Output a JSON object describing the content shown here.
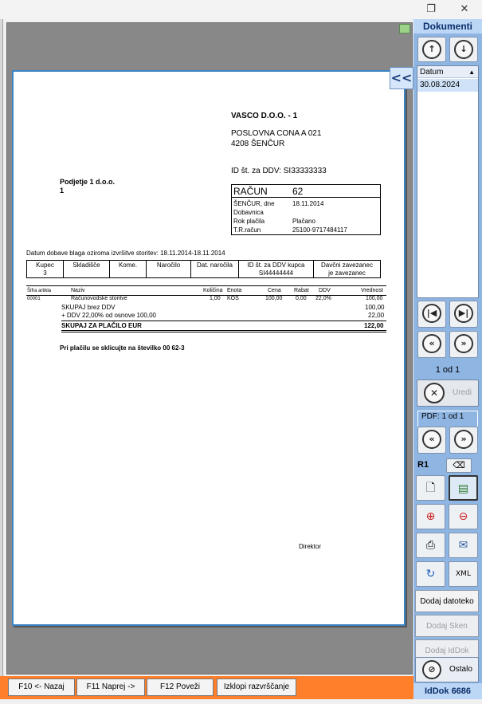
{
  "window": {
    "restore_icon": "restore-icon",
    "close_icon": "close-icon",
    "restore_glyph": "❐",
    "close_glyph": "✕"
  },
  "preview": {
    "collapse_label": "<<"
  },
  "document": {
    "company_name": "VASCO D.O.O. - 1",
    "company_address1": "POSLOVNA CONA A 021",
    "company_address2": "4208 ŠENČUR",
    "vat_id": "ID št. za DDV: SI33333333",
    "customer_name": "Podjetje 1 d.o.o.",
    "customer_code": "1",
    "invoice": {
      "title": "RAČUN",
      "number": "62",
      "rows": [
        {
          "label": "ŠENČUR, dne",
          "value": "18.11.2014"
        },
        {
          "label": "Dobavnica",
          "value": ""
        },
        {
          "label": "Rok plačila",
          "value": "Plačano"
        },
        {
          "label": "T.R.račun",
          "value": "25100-9717484117"
        }
      ]
    },
    "delivery_date": "Datum dobave blaga oziroma izvršitve storitev: 18.11.2014-18.11.2014",
    "header_cols": [
      {
        "label": "Kupec",
        "value": "3"
      },
      {
        "label": "Skladišče",
        "value": ""
      },
      {
        "label": "Kome.",
        "value": ""
      },
      {
        "label": "Naročilo",
        "value": ""
      },
      {
        "label": "Dat. naročila",
        "value": ""
      },
      {
        "label": "ID št. za DDV kupca",
        "value": "SI44444444"
      },
      {
        "label": "Davčni zavezanec",
        "value": "je zavezanec"
      }
    ],
    "items_header": {
      "sifra": "Šifra artikla",
      "naziv": "Naziv",
      "kolicina": "Količina",
      "enota": "Enota",
      "cena": "Cena",
      "rabat": "Rabat",
      "ddv": "DDV",
      "vrednost": "Vrednost"
    },
    "item": {
      "sifra": "00001",
      "naziv": "Računovodske storitve",
      "kolicina": "1,00",
      "enota": "KOS",
      "cena": "100,00",
      "rabat": "0,00",
      "ddv": "22,0%",
      "vrednost": "100,00"
    },
    "totals": [
      {
        "label": "SKUPAJ brez DDV",
        "value": "100,00"
      },
      {
        "label": "+ DDV 22,00% od osnove 100,00",
        "value": "22,00"
      }
    ],
    "grand_total_label": "SKUPAJ ZA PLAČILO EUR",
    "grand_total_value": "122,00",
    "payment_note": "Pri plačilu se sklicujte na številko 00 62-3",
    "signature": "Direktor"
  },
  "sidebar": {
    "title": "Dokumenti",
    "list_header": "Datum",
    "list_items": [
      "30.08.2024"
    ],
    "page_count": "1 od 1",
    "edit_label": "Uredi",
    "pdf_label": "PDF: 1 od 1",
    "r_label": "R1",
    "add_file": "Dodaj datoteko",
    "add_scan": "Dodaj Sken",
    "add_iddok": "Dodaj IdDok",
    "other": "Ostalo",
    "iddok": "IdDok 6686"
  },
  "footer": {
    "back": "F10 <- Nazaj",
    "forward": "F11 Naprej ->",
    "link": "F12 Poveži",
    "unsort": "Izklopi razvrščanje"
  },
  "colors": {
    "accent": "#8fb5e3",
    "footer": "#ff7f2a",
    "border": "#3a84c4"
  }
}
